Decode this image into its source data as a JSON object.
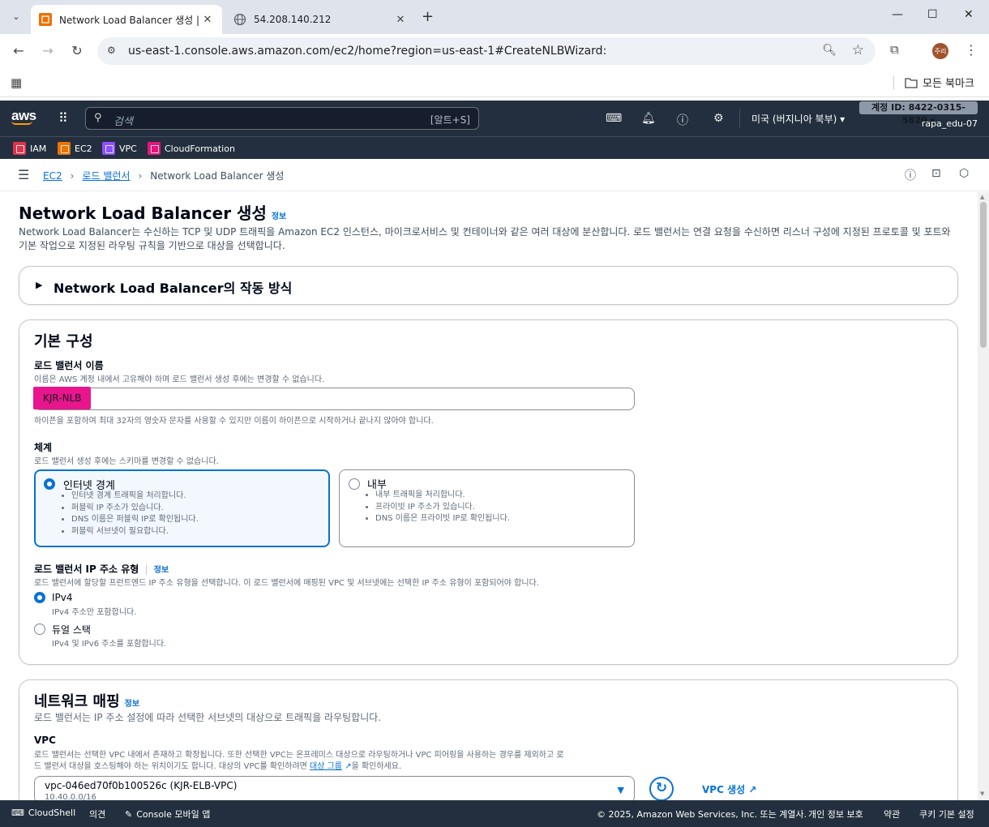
{
  "browser": {
    "tabs": [
      {
        "title": "Network Load Balancer 생성 |",
        "active": true
      },
      {
        "title": "54.208.140.212",
        "active": false
      }
    ],
    "url": "us-east-1.console.aws.amazon.com/ec2/home?region=us-east-1#CreateNLBWizard:",
    "profile_initials": "주리",
    "bookmarks_all": "모든 북마크"
  },
  "aws_header": {
    "logo": "aws",
    "search_placeholder": "검색",
    "search_shortcut": "[알트+S]",
    "region": "미국 (버지니아 북부) ▾",
    "account_id": "계정 ID: 8422-0315-5820 ▾",
    "user": "rapa_edu-07",
    "favorites": [
      {
        "label": "IAM",
        "color": "#dd344c"
      },
      {
        "label": "EC2",
        "color": "#ed7100"
      },
      {
        "label": "VPC",
        "color": "#8c4fff"
      },
      {
        "label": "CloudFormation",
        "color": "#e7157b"
      }
    ]
  },
  "breadcrumb": {
    "items": [
      "EC2",
      "로드 밸런서"
    ],
    "current": "Network Load Balancer 생성"
  },
  "page": {
    "title": "Network Load Balancer 생성",
    "info": "정보",
    "description": "Network Load Balancer는 수신하는 TCP 및 UDP 트래픽을 Amazon EC2 인스턴스, 마이크로서비스 및 컨테이너와 같은 여러 대상에 분산합니다. 로드 밸런서는 연결 요청을 수신하면 리스너 구성에 지정된 프로토콜 및 포트와 기본 작업으로 지정된 라우팅 규칙을 기반으로 대상을 선택합니다."
  },
  "how_it_works": {
    "title": "Network Load Balancer의 작동 방식"
  },
  "basic_config": {
    "title": "기본 구성",
    "name_label": "로드 밸런서 이름",
    "name_hint": "이름은 AWS 계정 내에서 고유해야 하며 로드 밸런서 생성 후에는 변경할 수 없습니다.",
    "name_value": "KJR-NLB",
    "name_constraint": "하이픈을 포함하여 최대 32자의 영숫자 문자를 사용할 수 있지만 이름이 하이픈으로 시작하거나 끝나지 않아야 합니다.",
    "scheme_label": "체계",
    "scheme_hint": "로드 밸런서 생성 후에는 스키마를 변경할 수 없습니다.",
    "scheme_options": [
      {
        "label": "인터넷 경계",
        "selected": true,
        "bullets": [
          "인터넷 경계 트래픽을 처리합니다.",
          "퍼블릭 IP 주소가 있습니다.",
          "DNS 이름은 퍼블릭 IP로 확인됩니다.",
          "퍼블릭 서브넷이 필요합니다."
        ]
      },
      {
        "label": "내부",
        "selected": false,
        "bullets": [
          "내부 트래픽을 처리합니다.",
          "프라이빗 IP 주소가 있습니다.",
          "DNS 이름은 프라이빗 IP로 확인됩니다."
        ]
      }
    ],
    "ip_type_label": "로드 밸런서 IP 주소 유형",
    "ip_type_info": "정보",
    "ip_type_hint": "로드 밸런서에 할당할 프런트엔드 IP 주소 유형을 선택합니다. 이 로드 밸런서에 매핑된 VPC 및 서브넷에는 선택한 IP 주소 유형이 포함되어야 합니다.",
    "ip_options": [
      {
        "label": "IPv4",
        "hint": "IPv4 주소만 포함합니다.",
        "selected": true
      },
      {
        "label": "듀얼 스택",
        "hint": "IPv4 및 IPv6 주소를 포함합니다.",
        "selected": false
      }
    ]
  },
  "network_mapping": {
    "title": "네트워크 매핑",
    "info": "정보",
    "description": "로드 밸런서는 IP 주소 설정에 따라 선택한 서브넷의 대상으로 트래픽을 라우팅합니다.",
    "vpc_label": "VPC",
    "vpc_hint_1": "로드 밸런서는 선택한 VPC 내에서 존재하고 확장됩니다. 또한 선택한 VPC는 온프레미스 대상으로 라우팅하거나 VPC 피어링을 사용하는 경우를 제외하고 로",
    "vpc_hint_2": "드 밸런서 대상을 호스팅해야 하는 위치이기도 합니다. 대상의 VPC를 확인하려면",
    "vpc_hint_link": "대상 그룹",
    "vpc_hint_3": "을 확인하세요.",
    "vpc_selected": "vpc-046ed70f0b100526c (KJR-ELB-VPC)",
    "vpc_cidr": "10.40.0.0/16",
    "vpc_create": "VPC 생성"
  },
  "footer": {
    "cloudshell": "CloudShell",
    "feedback": "의견",
    "mobile": "Console 모바일 앱",
    "copyright": "© 2025, Amazon Web Services, Inc. 또는 계열사.",
    "privacy": "개인 정보 보호",
    "terms": "약관",
    "cookies": "쿠키 기본 설정"
  }
}
